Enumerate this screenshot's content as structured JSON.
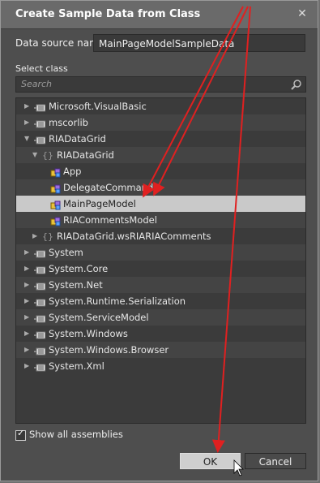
{
  "window": {
    "title": "Create Sample Data from Class"
  },
  "datasource": {
    "label": "Data source name",
    "value": "MainPageModelSampleData"
  },
  "select": {
    "label": "Select class",
    "search_placeholder": "Search"
  },
  "tree": [
    {
      "label": "Microsoft.VisualBasic",
      "level": 0,
      "icon": "assembly",
      "expanded": false
    },
    {
      "label": "mscorlib",
      "level": 0,
      "icon": "assembly",
      "expanded": false
    },
    {
      "label": "RIADataGrid",
      "level": 0,
      "icon": "assembly",
      "expanded": true
    },
    {
      "label": "RIADataGrid",
      "level": 1,
      "icon": "namespace",
      "expanded": true
    },
    {
      "label": "App",
      "level": 2,
      "icon": "class"
    },
    {
      "label": "DelegateCommand",
      "level": 2,
      "icon": "class"
    },
    {
      "label": "MainPageModel",
      "level": 2,
      "icon": "class",
      "selected": true
    },
    {
      "label": "RIACommentsModel",
      "level": 2,
      "icon": "class"
    },
    {
      "label": "RIADataGrid.wsRIARIAComments",
      "level": 1,
      "icon": "namespace",
      "expanded": false
    },
    {
      "label": "System",
      "level": 0,
      "icon": "assembly",
      "expanded": false
    },
    {
      "label": "System.Core",
      "level": 0,
      "icon": "assembly",
      "expanded": false
    },
    {
      "label": "System.Net",
      "level": 0,
      "icon": "assembly",
      "expanded": false
    },
    {
      "label": "System.Runtime.Serialization",
      "level": 0,
      "icon": "assembly",
      "expanded": false
    },
    {
      "label": "System.ServiceModel",
      "level": 0,
      "icon": "assembly",
      "expanded": false
    },
    {
      "label": "System.Windows",
      "level": 0,
      "icon": "assembly",
      "expanded": false
    },
    {
      "label": "System.Windows.Browser",
      "level": 0,
      "icon": "assembly",
      "expanded": false
    },
    {
      "label": "System.Xml",
      "level": 0,
      "icon": "assembly",
      "expanded": false
    }
  ],
  "options": {
    "show_all_label": "Show all assemblies",
    "show_all_checked": true
  },
  "buttons": {
    "ok": "OK",
    "cancel": "Cancel"
  },
  "colors": {
    "arrow": "#e02020",
    "selected_row": "#c9c9c9"
  }
}
